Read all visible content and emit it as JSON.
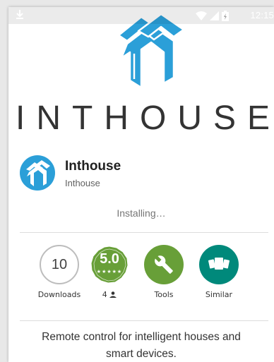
{
  "status_bar": {
    "time": "12:15",
    "download_icon": "download-icon",
    "wifi_icon": "wifi-icon",
    "signal_icon": "signal-icon",
    "battery_icon": "battery-charging-icon"
  },
  "app_bar": {
    "back_icon": "arrow-back-icon",
    "search_icon": "search-icon",
    "more_icon": "more-vert-icon"
  },
  "hero": {
    "wordmark": "INTHOUSE",
    "logo_icon": "inthouse-logo-icon"
  },
  "app": {
    "title": "Inthouse",
    "developer": "Inthouse",
    "status": "Installing…"
  },
  "stats": {
    "downloads_value": "10",
    "downloads_label": "Downloads",
    "rating_value": "5.0",
    "rating_stars": "★★★★★",
    "rating_count": "4",
    "tools_label": "Tools",
    "similar_label": "Similar"
  },
  "description": "Remote control for intelligent houses and smart devices.",
  "colors": {
    "brand_blue": "#2b9fd8",
    "rating_green": "#689f38",
    "tools_green": "#689f38",
    "similar_teal": "#00897b"
  }
}
